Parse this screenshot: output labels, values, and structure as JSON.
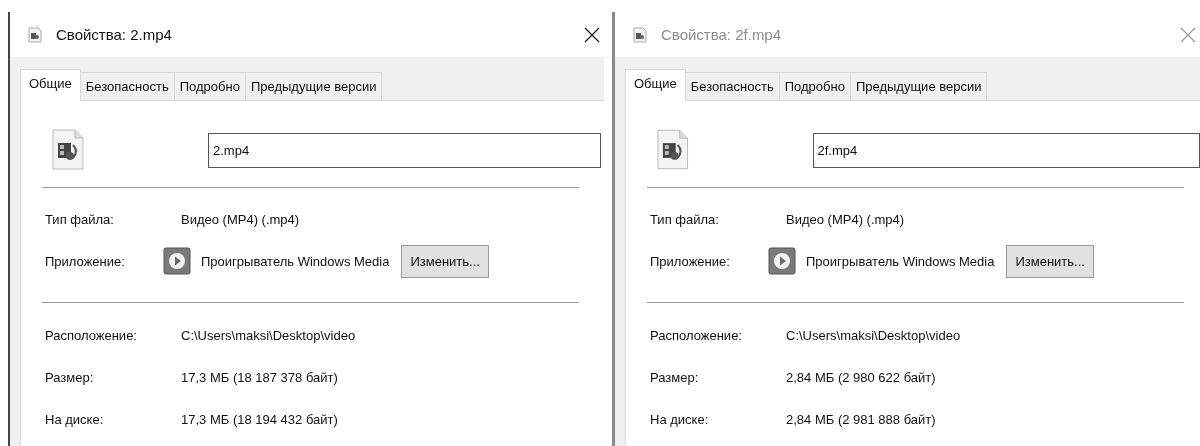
{
  "dialogs": [
    {
      "title": "Свойства: 2.mp4",
      "active": true,
      "tabs": [
        {
          "label": "Общие",
          "selected": true
        },
        {
          "label": "Безопасность",
          "selected": false
        },
        {
          "label": "Подробно",
          "selected": false
        },
        {
          "label": "Предыдущие версии",
          "selected": false
        }
      ],
      "file_name": "2.mp4",
      "type_rows": [
        {
          "kind": "text",
          "label": "Тип файла:",
          "value": "Видео (MP4) (.mp4)"
        },
        {
          "kind": "app",
          "label": "Приложение:",
          "value": "Проигрыватель Windows Media",
          "button": "Изменить..."
        }
      ],
      "location_rows": [
        {
          "kind": "text",
          "label": "Расположение:",
          "value": "C:\\Users\\maksi\\Desktop\\video"
        },
        {
          "kind": "text",
          "label": "Размер:",
          "value": "17,3 МБ (18 187 378 байт)"
        },
        {
          "kind": "text",
          "label": "На диске:",
          "value": "17,3 МБ (18 194 432 байт)"
        }
      ]
    },
    {
      "title": "Свойства: 2f.mp4",
      "active": false,
      "tabs": [
        {
          "label": "Общие",
          "selected": true
        },
        {
          "label": "Безопасность",
          "selected": false
        },
        {
          "label": "Подробно",
          "selected": false
        },
        {
          "label": "Предыдущие версии",
          "selected": false
        }
      ],
      "file_name": "2f.mp4",
      "type_rows": [
        {
          "kind": "text",
          "label": "Тип файла:",
          "value": "Видео (MP4) (.mp4)"
        },
        {
          "kind": "app",
          "label": "Приложение:",
          "value": "Проигрыватель Windows Media",
          "button": "Изменить..."
        }
      ],
      "location_rows": [
        {
          "kind": "text",
          "label": "Расположение:",
          "value": "C:\\Users\\maksi\\Desktop\\video"
        },
        {
          "kind": "text",
          "label": "Размер:",
          "value": "2,84 МБ (2 980 622 байт)"
        },
        {
          "kind": "text",
          "label": "На диске:",
          "value": "2,84 МБ (2 981 888 байт)"
        }
      ]
    }
  ]
}
